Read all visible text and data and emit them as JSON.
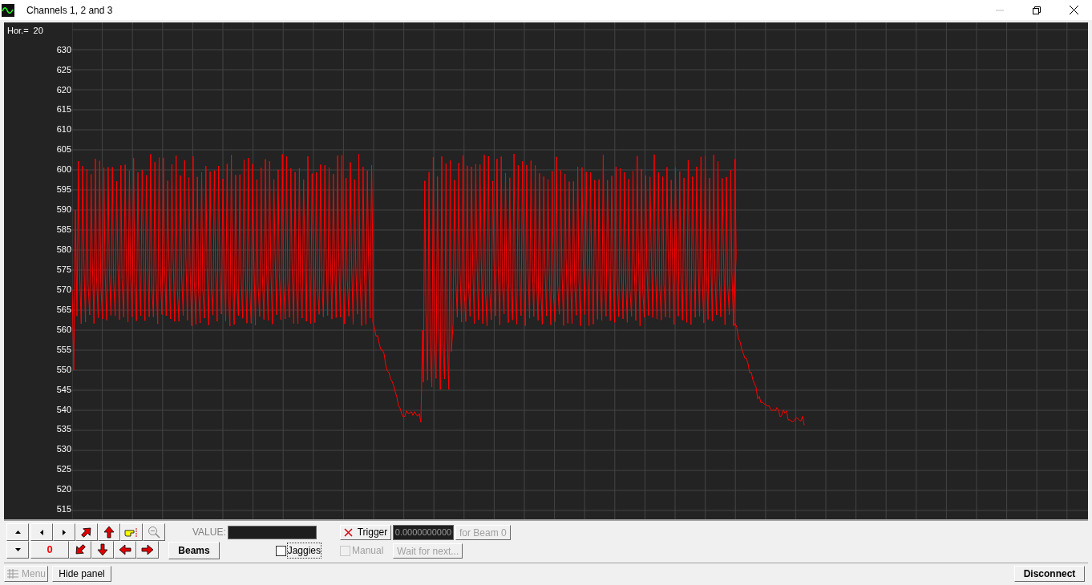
{
  "window": {
    "title": "Channels 1, 2 and 3"
  },
  "plot": {
    "scale_label": "Hor.=",
    "scale_value": "20",
    "axis_labels": [
      "630",
      "625",
      "620",
      "615",
      "610",
      "605",
      "600",
      "595",
      "590",
      "585",
      "580",
      "575",
      "570",
      "565",
      "560",
      "555",
      "550",
      "545",
      "540",
      "535",
      "530",
      "525",
      "520",
      "515"
    ]
  },
  "panel": {
    "counter": "0",
    "value_label": "VALUE:",
    "beams_button": "Beams",
    "jaggies": {
      "label": "Jaggies",
      "checked": false
    },
    "trigger_button": "Trigger",
    "trigger_value": "0.0000000000",
    "beam_button": {
      "label": "for Beam 0",
      "disabled": true
    },
    "manual": {
      "label": "Manual",
      "checked": false,
      "disabled": true
    },
    "wait_button": {
      "label": "Wait for next...",
      "disabled": true
    }
  },
  "footer": {
    "menu_button": {
      "label": "Menu",
      "disabled": true
    },
    "hide_button": "Hide panel",
    "disconnect_button": "Disconnect"
  }
}
